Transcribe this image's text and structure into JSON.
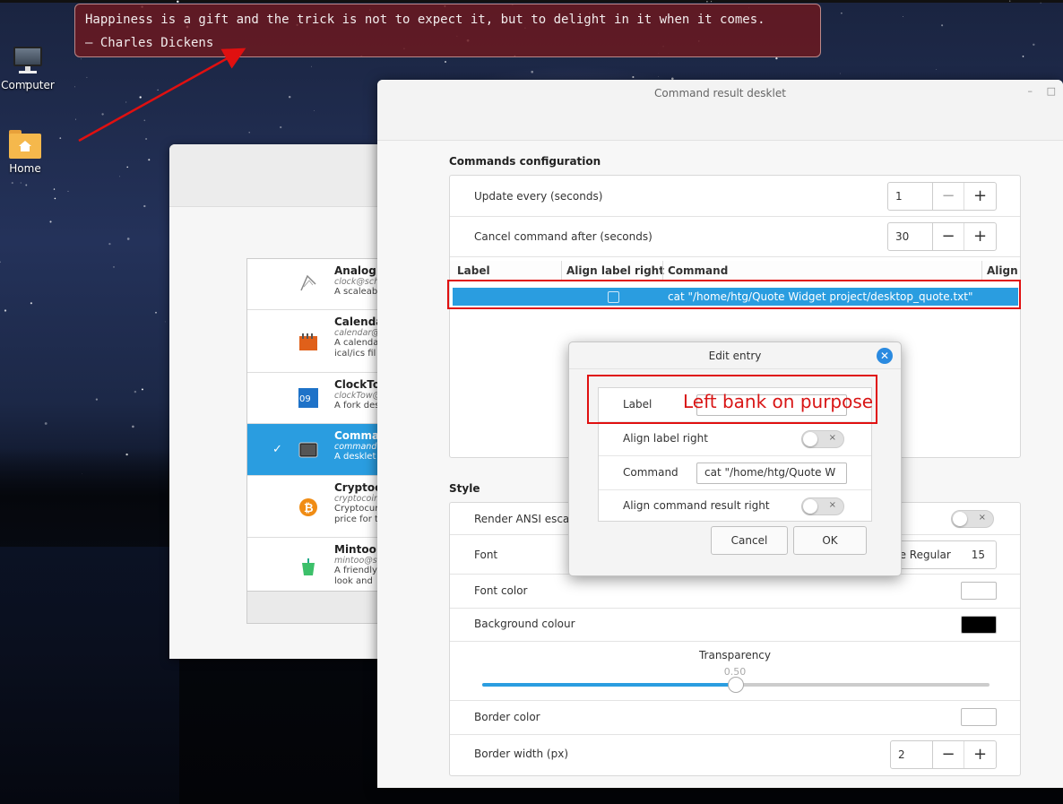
{
  "quote": {
    "text": "Happiness is a gift and the trick is not to expect it, but to delight in it when it comes.",
    "author": "— Charles Dickens"
  },
  "desktop_icons": [
    {
      "label": "Computer",
      "icon": "computer-icon"
    },
    {
      "label": "Home",
      "icon": "home-folder-icon"
    }
  ],
  "desklet_list": [
    {
      "name": "Analog C",
      "uuid": "clock@sch",
      "desc1": "A scaleab",
      "desc2": "",
      "icon": "analog-clock-icon"
    },
    {
      "name": "Calenda",
      "uuid": "calendar@",
      "desc1": "A calenda",
      "desc2": "ical/ics fil",
      "icon": "calendar-icon"
    },
    {
      "name": "ClockTo",
      "uuid": "clockTow@",
      "desc1": "A fork des",
      "desc2": "",
      "icon": "clocktower-icon"
    },
    {
      "name": "Comman",
      "uuid": "command",
      "desc1": "A desklet",
      "desc2": "",
      "icon": "terminal-icon",
      "selected": true
    },
    {
      "name": "Cryptoc",
      "uuid": "cryptocoin",
      "desc1": "Cryptocur",
      "desc2": "price for t",
      "icon": "bitcoin-icon"
    },
    {
      "name": "Mintoo",
      "uuid": "mintoo@s",
      "desc1": "A friendly",
      "desc2": "look and",
      "icon": "mintoo-icon"
    }
  ],
  "window": {
    "title": "Command result desklet",
    "minimize": "–",
    "maximize": "□"
  },
  "commands_config": {
    "heading": "Commands configuration",
    "update_label": "Update every (seconds)",
    "update_value": "1",
    "cancel_label": "Cancel command after (seconds)",
    "cancel_value": "30",
    "columns": [
      "Label",
      "Align label right",
      "Command",
      "Align"
    ],
    "rows": [
      {
        "label": "",
        "align_label_right": false,
        "command": "cat \"/home/htg/Quote Widget project/desktop_quote.txt\""
      }
    ],
    "toolbar": {
      "add": "+",
      "remove": "−",
      "edit": "✎",
      "up": "⌃"
    }
  },
  "style": {
    "heading": "Style",
    "render_ansi_label": "Render ANSI escap",
    "font_label": "Font",
    "font_value": "ce Regular",
    "font_size": "15",
    "font_color_label": "Font color",
    "font_color": "#ffffff",
    "background_label": "Background colour",
    "background_color": "#000000",
    "transparency_label": "Transparency",
    "transparency_value": "0.50",
    "transparency_fraction": 0.5,
    "border_color_label": "Border color",
    "border_color": "#ffffff",
    "border_width_label": "Border width (px)",
    "border_width_value": "2"
  },
  "edit_dialog": {
    "title": "Edit entry",
    "label_field": "Label",
    "label_value": "",
    "align_label_right": "Align label right",
    "command_field": "Command",
    "command_value": "cat \"/home/htg/Quote W",
    "align_result_right": "Align command result right",
    "cancel": "Cancel",
    "ok": "OK"
  },
  "annotation": {
    "text": "Left bank on purpose",
    "color": "#e01010"
  },
  "colors": {
    "accent": "#2a9de0",
    "quote_bg": "#6e191e"
  }
}
